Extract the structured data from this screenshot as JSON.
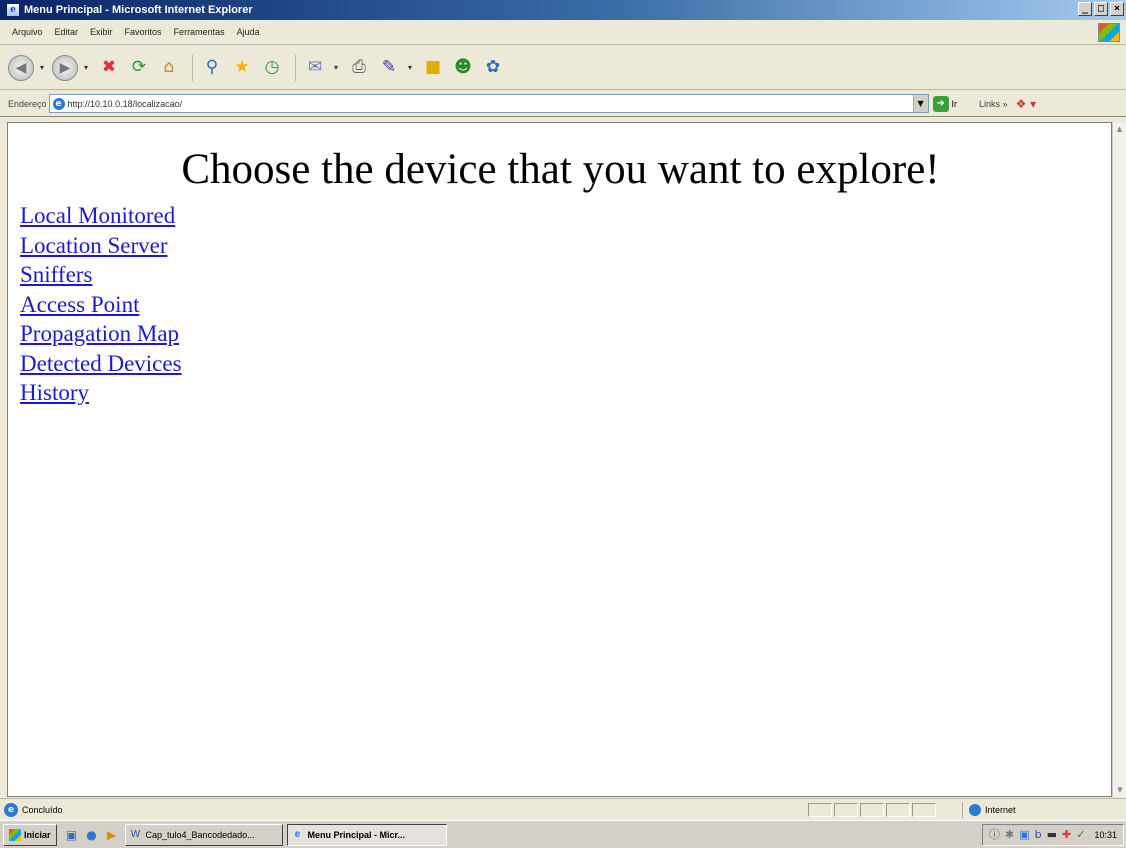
{
  "window": {
    "title": "Menu Principal - Microsoft Internet Explorer",
    "controls": [
      "_",
      "□",
      "×"
    ]
  },
  "menubar": {
    "items": [
      "Arquivo",
      "Editar",
      "Exibir",
      "Favoritos",
      "Ferramentas",
      "Ajuda"
    ]
  },
  "toolbar": {
    "icons": [
      "back-icon",
      "forward-icon",
      "stop-icon",
      "refresh-icon",
      "home-icon",
      "search-icon",
      "favorites-icon",
      "history-icon",
      "mail-icon",
      "print-icon",
      "edit-icon",
      "discuss-icon",
      "messenger-icon",
      "research-icon"
    ]
  },
  "addressbar": {
    "label": "Endereço",
    "url": "http://10.10.0.18/localizacao/",
    "go_label": "Ir",
    "links_label": "Links"
  },
  "page": {
    "heading": "Choose the device that you want to explore!",
    "links": [
      "Local Monitored",
      "Location Server",
      "Sniffers",
      "Access Point",
      "Propagation Map",
      "Detected Devices",
      "History"
    ]
  },
  "statusbar": {
    "text": "Concluído",
    "zone": "Internet"
  },
  "taskbar": {
    "start_label": "Iniciar",
    "tasks": [
      "Cap_tulo4_Bancodedado...",
      "Menu Principal - Micr..."
    ],
    "clock": "10:31"
  },
  "colors": {
    "link": "#1c1ccc",
    "titlebar": "#0a246a"
  }
}
